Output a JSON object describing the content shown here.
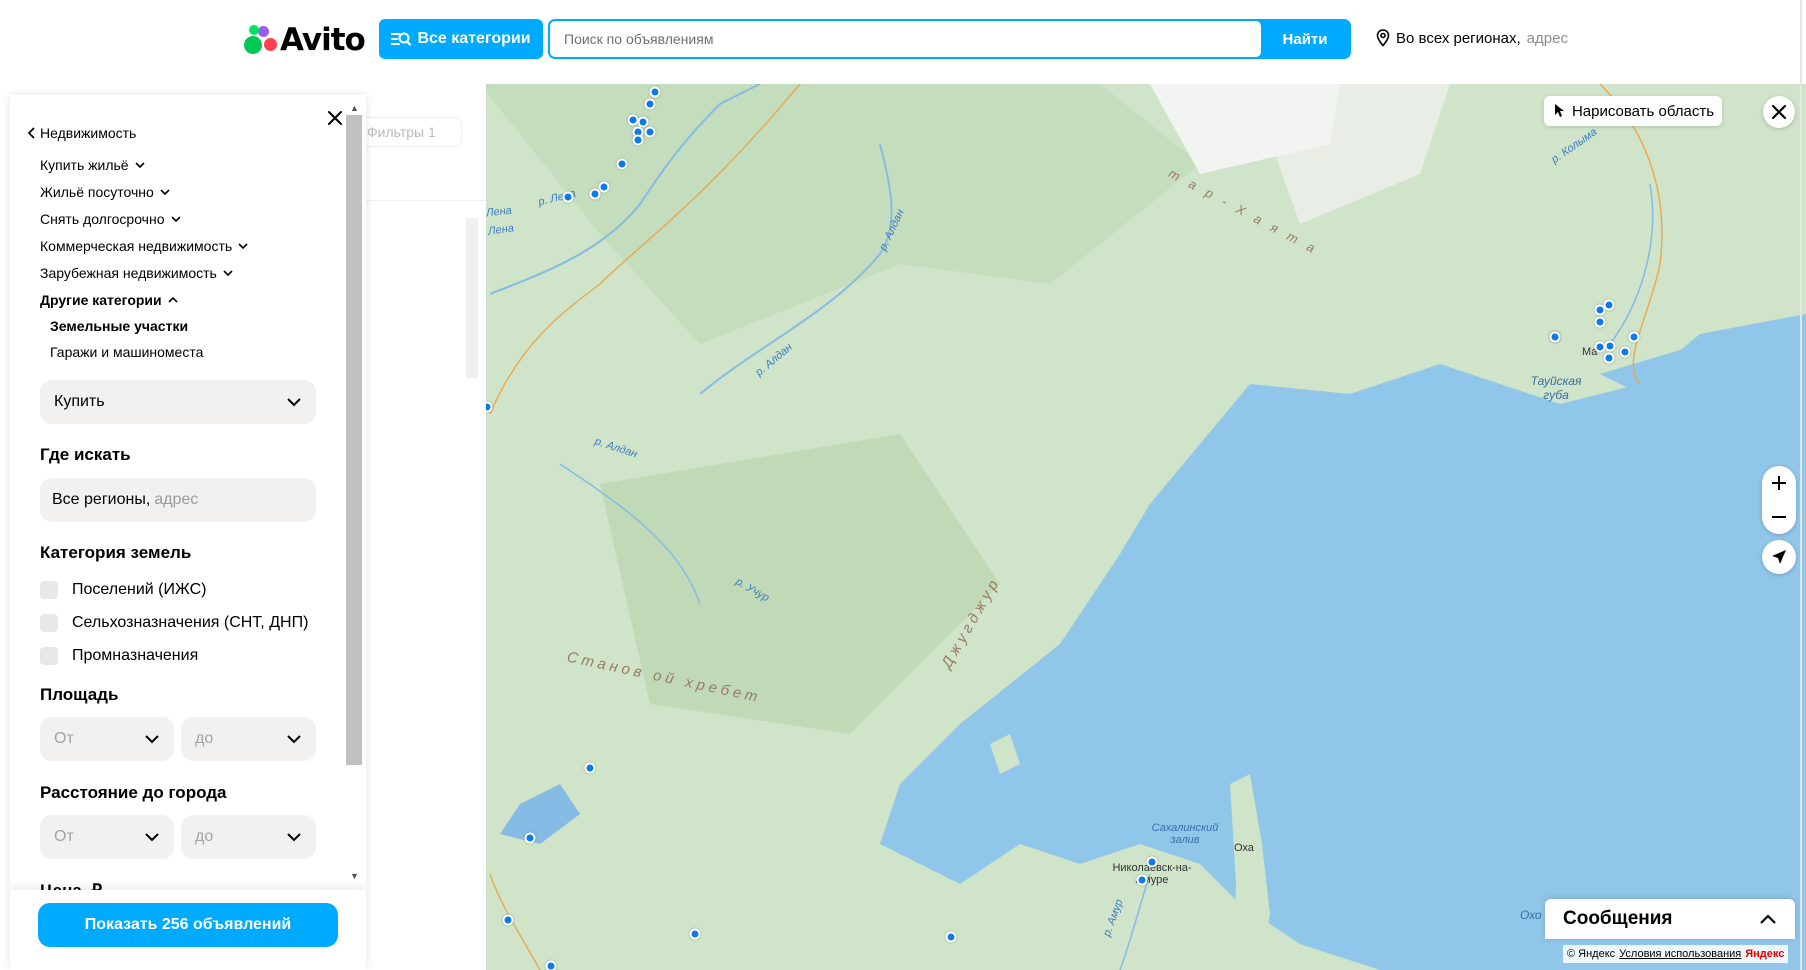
{
  "header": {
    "logo_text": "Avito",
    "categories_button": "Все категории",
    "search_placeholder": "Поиск по объявлениям",
    "search_button": "Найти",
    "region_main": "Во всех регионах,",
    "region_muted": "адрес"
  },
  "list_panel": {
    "filters_label": "Фильтры 1"
  },
  "filters": {
    "breadcrumb": "Недвижимость",
    "categories": [
      {
        "label": "Купить жильё",
        "expanded": false
      },
      {
        "label": "Жильё посуточно",
        "expanded": false
      },
      {
        "label": "Снять долгосрочно",
        "expanded": false
      },
      {
        "label": "Коммерческая недвижимость",
        "expanded": false
      },
      {
        "label": "Зарубежная недвижимость",
        "expanded": false
      },
      {
        "label": "Другие категории",
        "expanded": true
      }
    ],
    "subcategories": [
      {
        "label": "Земельные участки",
        "active": true
      },
      {
        "label": "Гаражи и машиноместа",
        "active": false
      }
    ],
    "deal_type": "Купить",
    "where_title": "Где искать",
    "where_value": "Все регионы,",
    "where_muted": "адрес",
    "land_category_title": "Категория земель",
    "land_categories": [
      {
        "label": "Поселений (ИЖС)",
        "checked": false
      },
      {
        "label": "Сельхозназначения (СНТ, ДНП)",
        "checked": false
      },
      {
        "label": "Промназначения",
        "checked": false
      }
    ],
    "area_title": "Площадь",
    "area_from": "От",
    "area_to": "до",
    "distance_title": "Расстояние до города",
    "distance_from": "От",
    "distance_to": "до",
    "price_title_cut": "Цена, ₽",
    "show_button": "Показать 256 объявлений"
  },
  "map": {
    "draw_area": "Нарисовать область",
    "messages": "Сообщения",
    "copyright": "© Яндекс",
    "terms": "Условия использования",
    "yandex": "Яндекс",
    "labels": {
      "mountain1": "Станов ой хребет",
      "mountain2": "Джугджур",
      "mountain3": "т а р - Х а я т а",
      "river_lena1": "Лена",
      "river_lena2": "Лена",
      "river_lena3": "р. Лена",
      "river_aldan1": "р. Алдан",
      "river_aldan2": "р. Алдан",
      "river_aldan3": "р. Алдан",
      "river_uchur": "р. Учур",
      "river_kolyma": "р. Колыма",
      "river_amur": "р. Амур",
      "bay_tauy": "Тауйская губа",
      "bay_sakhalin": "Сахалинский залив",
      "city_okha": "Оха",
      "city_nikolaevsk": "Николаевск-на-Амуре",
      "city_magadan": "Ма",
      "sea_okhotsk": "Охо"
    }
  },
  "colors": {
    "accent": "#00aaff",
    "marker": "#0a7be8",
    "land": "#cfe4c9",
    "sea": "#8fc6ea"
  }
}
